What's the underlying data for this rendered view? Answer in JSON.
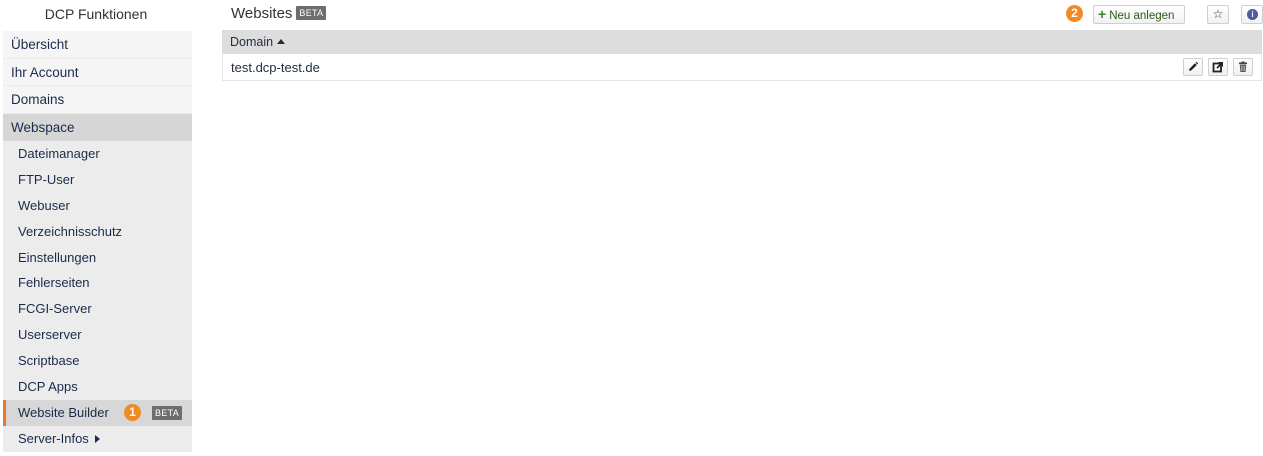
{
  "sidebar": {
    "title": "DCP Funktionen",
    "top_items": [
      {
        "label": "Übersicht"
      },
      {
        "label": "Ihr Account"
      },
      {
        "label": "Domains"
      },
      {
        "label": "Webspace"
      }
    ],
    "sub_items": [
      {
        "label": "Dateimanager"
      },
      {
        "label": "FTP-User"
      },
      {
        "label": "Webuser"
      },
      {
        "label": "Verzeichnisschutz"
      },
      {
        "label": "Einstellungen"
      },
      {
        "label": "Fehlerseiten"
      },
      {
        "label": "FCGI-Server"
      },
      {
        "label": "Userserver"
      },
      {
        "label": "Scriptbase"
      },
      {
        "label": "DCP Apps"
      },
      {
        "label": "Website Builder",
        "badge_number": "1",
        "badge_text": "BETA"
      },
      {
        "label": "Server-Infos"
      }
    ]
  },
  "main": {
    "title": "Websites",
    "title_badge": "BETA",
    "toolbar": {
      "step_badge": "2",
      "new_label": "Neu anlegen",
      "star_icon": "star-icon",
      "info_icon": "info-icon"
    },
    "table": {
      "columns": [
        {
          "label": "Domain",
          "sort": "ascending"
        }
      ],
      "rows": [
        {
          "domain": "test.dcp-test.de",
          "actions": [
            "edit-icon",
            "open-external-icon",
            "trash-icon"
          ]
        }
      ]
    }
  },
  "colors": {
    "accent_orange": "#f08a24",
    "beta_badge": "#6d6d6d",
    "active_bg": "#d6d6d6",
    "info_blue": "#4d5b9c",
    "new_green": "#2f8a1f"
  }
}
